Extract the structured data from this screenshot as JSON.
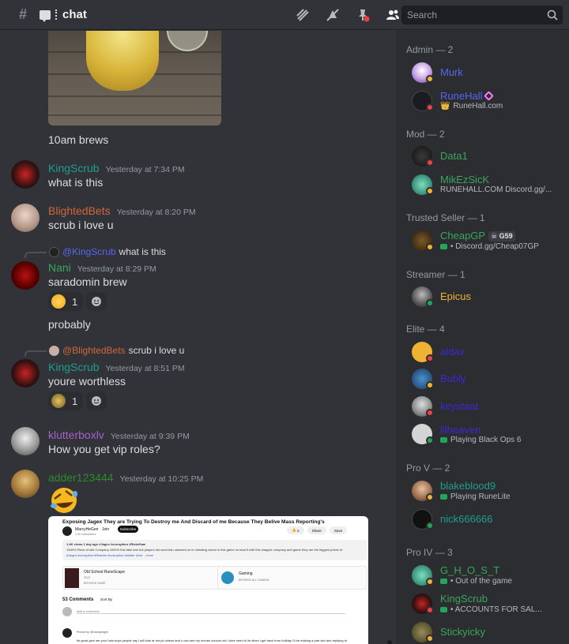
{
  "header": {
    "channel_name": "chat",
    "search_placeholder": "Search"
  },
  "messages": [
    {
      "text": "10am brews"
    },
    {
      "user": "KingScrub",
      "color": "#1f9e8c",
      "time": "Yesterday at 7:34 PM",
      "text": "what is this"
    },
    {
      "user": "BlightedBets",
      "color": "#d1673b",
      "time": "Yesterday at 8:20 PM",
      "text": "scrub i love u"
    },
    {
      "reply_user": "@KingScrub",
      "reply_text": "what is this",
      "user": "Nani",
      "color": "#3ba55c",
      "time": "Yesterday at 8:29 PM",
      "text": "saradomin brew",
      "reaction_count": "1"
    },
    {
      "text": "probably"
    },
    {
      "reply_user": "@BlightedBets",
      "reply_text": "scrub i love u",
      "user": "KingScrub",
      "color": "#1f9e8c",
      "time": "Yesterday at 8:51 PM",
      "text": "youre worthless",
      "reaction_count": "1"
    },
    {
      "user": "klutterboxlv",
      "color": "#a561c9",
      "time": "Yesterday at 9:39 PM",
      "text": "How you get vip roles?"
    },
    {
      "user": "adder123444",
      "color": "#2d8a2d",
      "time": "Yesterday at 10:25 PM"
    }
  ],
  "embed": {
    "title": "Exposing Jagex They are Trying To Destroy me And Discard of me Because They Belive Mass Reporting's",
    "channel": "MarcyHeGen",
    "subscribers": "1.39 subscribers",
    "join": "Join",
    "subscribe": "Subscribe",
    "likes": "2",
    "share": "Share",
    "save": "Save",
    "desc_line1": "1.4K views  1 day ago  #Jagex #corruption #RiskeSaw",
    "desc_line2": "1000% Piece of shit Company 1000% this fake ban bot players but wont ban clanners on in cheating comm in this game no lead it with this chappie company and game they are the biggest prices of",
    "desc_line3": "#Jagex #corruption #Rashee #corruption #ladder #Arrr ...more",
    "card1_title": "Old School RuneScape",
    "card1_year": "2013",
    "card1_sub": "BROWSE GAME",
    "card2_title": "Gaming",
    "card2_sub": "BROWSE ALL GAMING",
    "comments": "53 Comments",
    "sort": "Sort By",
    "add_comment": "Add a comment...",
    "comment_user": "Pinned by @marcyhegen",
    "comment_text": "Its good give me your halo boys people say i will look at ma pk videos and u can see my mouse cursors etc i dont need to lie when i get back from holiday i'll be making a part two and replying to"
  },
  "members": {
    "admin_header": "Admin — 2",
    "admin": [
      {
        "name": "Murk",
        "color": "#5865f2"
      },
      {
        "name": "RuneHall",
        "color": "#5865f2",
        "sub": "RuneHall.com"
      }
    ],
    "mod_header": "Mod — 2",
    "mod": [
      {
        "name": "Data1",
        "color": "#3ba55c"
      },
      {
        "name": "MikEzSicK",
        "color": "#3ba55c",
        "sub": "RUNEHALL.COM Discord.gg/..."
      }
    ],
    "trusted_header": "Trusted Seller — 1",
    "trusted": [
      {
        "name": "CheapGP",
        "color": "#3ba55c",
        "tag": "G59",
        "sub": "• Discord.gg/Cheap07GP"
      }
    ],
    "streamer_header": "Streamer — 1",
    "streamer": [
      {
        "name": "Epicus",
        "color": "#f0b232"
      }
    ],
    "elite_header": "Elite — 4",
    "elite": [
      {
        "name": "aldax",
        "color": "#3a2ad6"
      },
      {
        "name": "Bubly",
        "color": "#3a2ad6"
      },
      {
        "name": "keystaat",
        "color": "#3a2ad6"
      },
      {
        "name": "lilheaven",
        "color": "#3a2ad6",
        "sub": "Playing Black Ops 6"
      }
    ],
    "prov_header": "Pro V — 2",
    "prov": [
      {
        "name": "blakeblood9",
        "color": "#1f9e8c",
        "sub": "Playing RuneLite"
      },
      {
        "name": "nick666666",
        "color": "#1f9e8c"
      }
    ],
    "proiv_header": "Pro IV — 3",
    "proiv": [
      {
        "name": "G_H_O_S_T",
        "color": "#3ba55c",
        "sub": "• Out of the game"
      },
      {
        "name": "KingScrub",
        "color": "#3ba55c",
        "sub": "•       ACCOUNTS FOR SAL..."
      },
      {
        "name": "Stickyicky",
        "color": "#3ba55c"
      }
    ]
  }
}
